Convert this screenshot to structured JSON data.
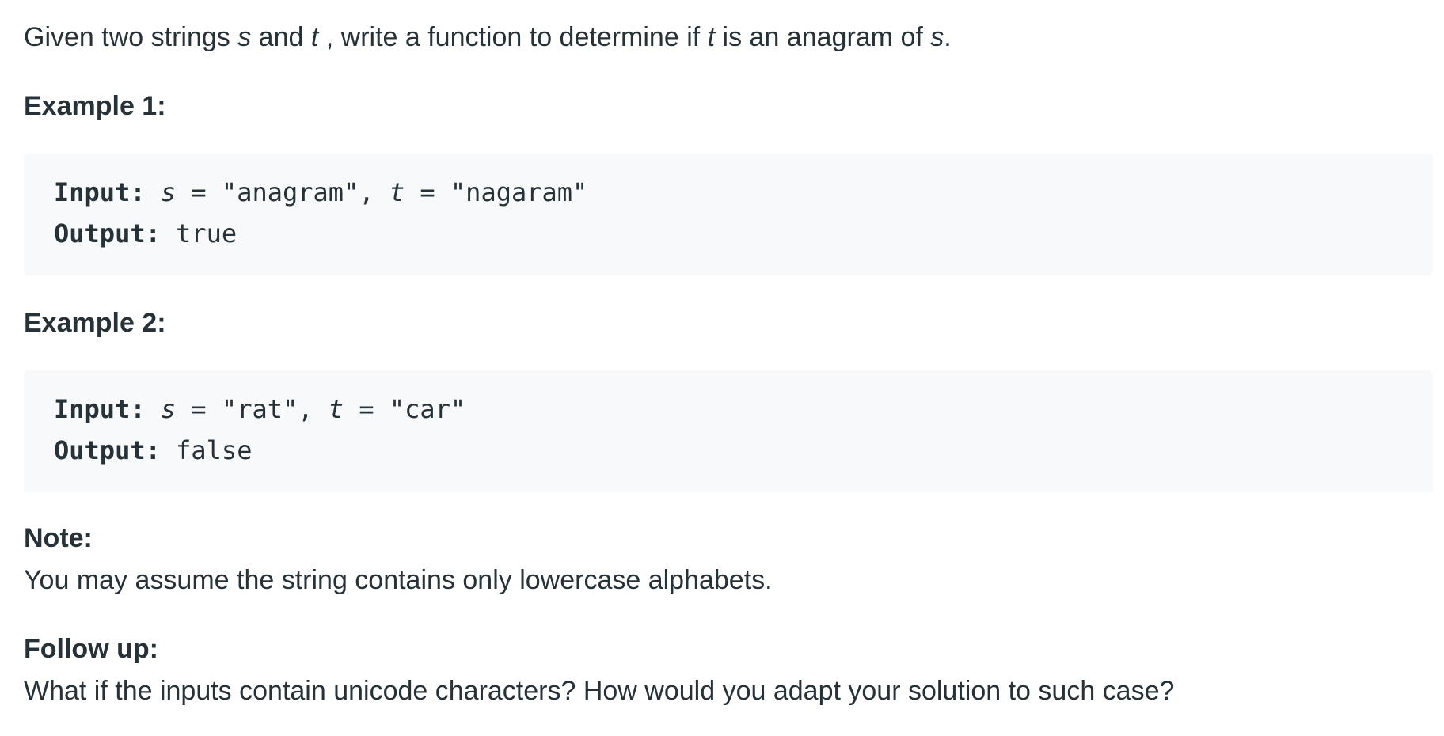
{
  "intro": {
    "part1": "Given two strings ",
    "s": "s",
    "part2": " and ",
    "t": "t",
    "part3": " , write a function to determine if ",
    "t2": "t",
    "part4": " is an anagram of ",
    "s2": "s",
    "part5": "."
  },
  "example1": {
    "heading": "Example 1:",
    "input_label": "Input:",
    "s_var": "s",
    "s_assign": " = \"anagram\", ",
    "t_var": "t",
    "t_assign": " = \"nagaram\"",
    "output_label": "Output:",
    "output_value": " true"
  },
  "example2": {
    "heading": "Example 2:",
    "input_label": "Input:",
    "s_var": "s",
    "s_assign": " = \"rat\", ",
    "t_var": "t",
    "t_assign": " = \"car\"",
    "output_label": "Output:",
    "output_value": " false"
  },
  "note": {
    "heading": "Note:",
    "text": "You may assume the string contains only lowercase alphabets."
  },
  "follow_up": {
    "heading": "Follow up:",
    "text": "What if the inputs contain unicode characters? How would you adapt your solution to such case?"
  }
}
